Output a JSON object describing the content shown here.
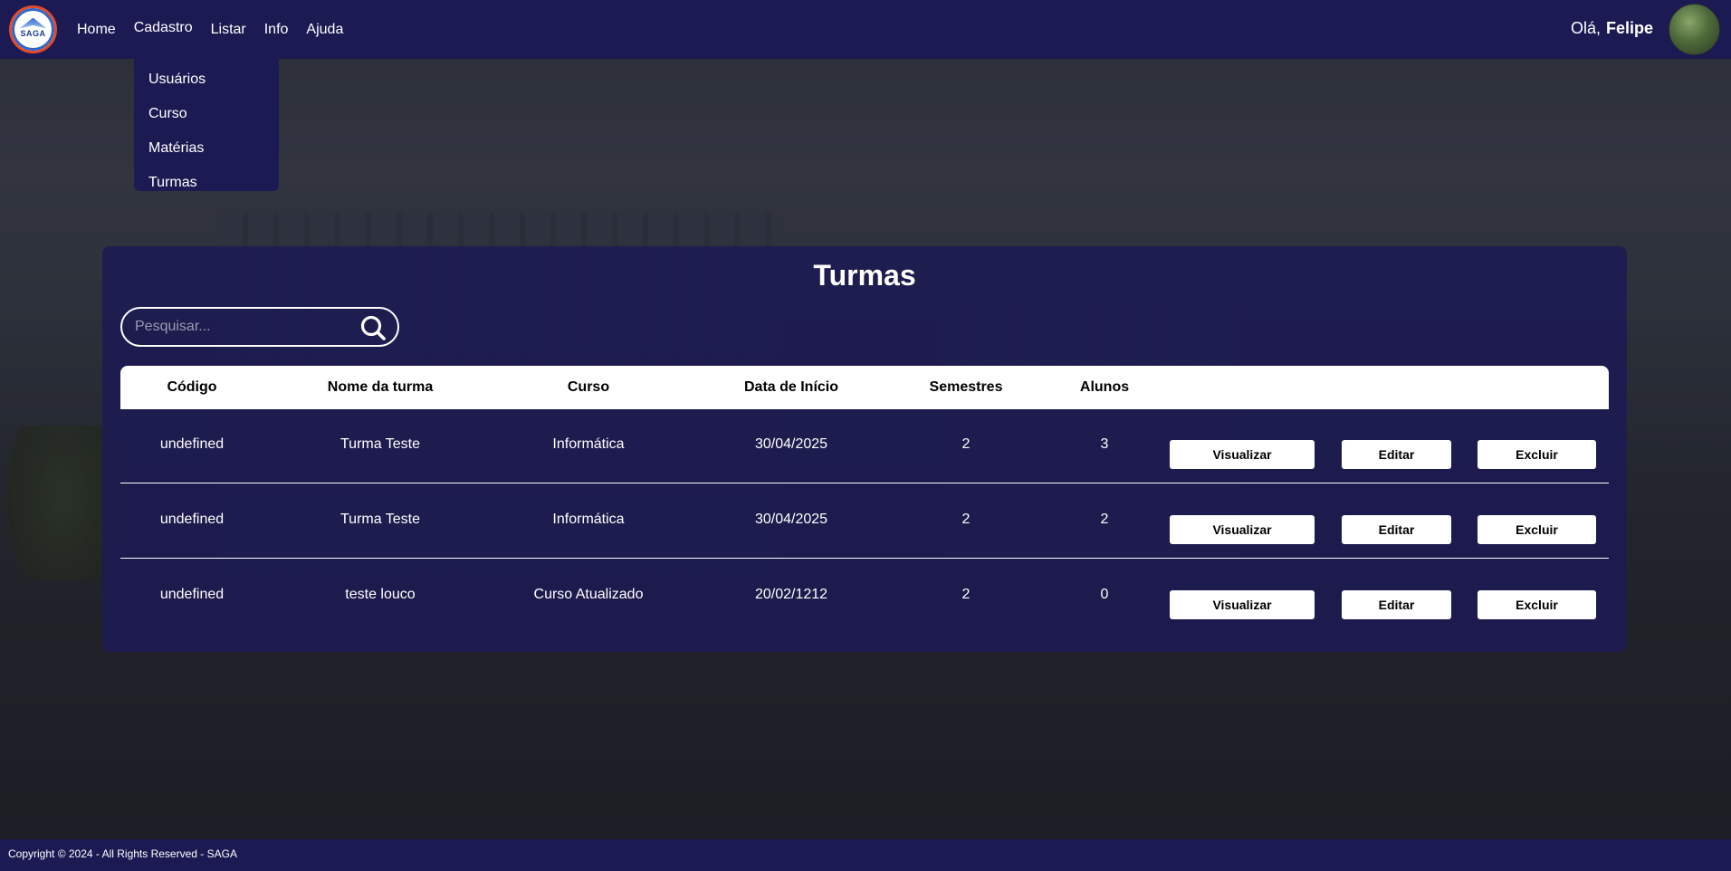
{
  "nav": {
    "logo_text": "SAGA",
    "links": [
      "Home",
      "Cadastro",
      "Listar",
      "Info",
      "Ajuda"
    ],
    "greeting": "Olá,",
    "user_name": "Felipe"
  },
  "dropdown": {
    "items": [
      "Usuários",
      "Curso",
      "Matérias",
      "Turmas"
    ]
  },
  "main": {
    "title": "Turmas",
    "search_placeholder": "Pesquisar...",
    "columns": [
      "Código",
      "Nome da turma",
      "Curso",
      "Data de Início",
      "Semestres",
      "Alunos"
    ],
    "rows": [
      {
        "codigo": "undefined",
        "nome": "Turma Teste",
        "curso": "Informática",
        "data": "30/04/2025",
        "semestres": "2",
        "alunos": "3"
      },
      {
        "codigo": "undefined",
        "nome": "Turma Teste",
        "curso": "Informática",
        "data": "30/04/2025",
        "semestres": "2",
        "alunos": "2"
      },
      {
        "codigo": "undefined",
        "nome": "teste louco",
        "curso": "Curso Atualizado",
        "data": "20/02/1212",
        "semestres": "2",
        "alunos": "0"
      }
    ],
    "actions": {
      "view": "Visualizar",
      "edit": "Editar",
      "delete": "Excluir"
    }
  },
  "footer": {
    "copyright": "Copyright © 2024 - All Rights Reserved - SAGA"
  },
  "colors": {
    "navy": "#1c1a52",
    "logo_ring": "#e34a2b"
  }
}
